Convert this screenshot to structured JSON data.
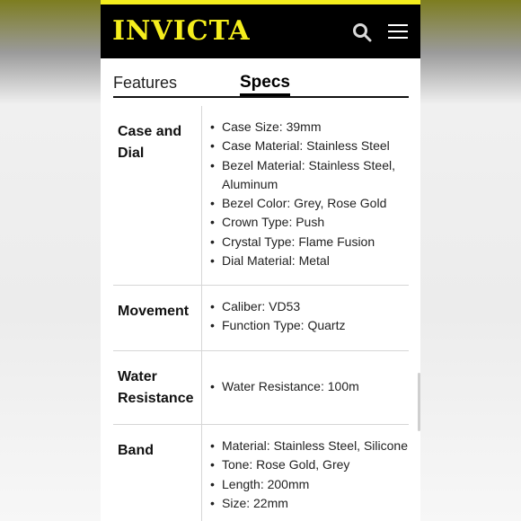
{
  "header": {
    "logo": "INVICTA",
    "search_icon": "search-icon",
    "menu_icon": "hamburger-menu-icon",
    "brand_color": "#f5ee1d"
  },
  "tabs": [
    {
      "label": "Features",
      "active": false
    },
    {
      "label": "Specs",
      "active": true
    }
  ],
  "specs": [
    {
      "label": "Case and Dial",
      "items": [
        "Case Size: 39mm",
        "Case Material: Stainless Steel",
        "Bezel Material: Stainless Steel, Aluminum",
        "Bezel Color: Grey, Rose Gold",
        "Crown Type: Push",
        "Crystal Type: Flame Fusion",
        "Dial Material: Metal"
      ]
    },
    {
      "label": "Movement",
      "items": [
        "Caliber: VD53",
        "Function Type: Quartz"
      ]
    },
    {
      "label": "Water Resistance",
      "items": [
        "Water Resistance: 100m"
      ]
    },
    {
      "label": "Band",
      "items": [
        "Material: Stainless Steel, Silicone",
        "Tone: Rose Gold, Grey",
        "Length: 200mm",
        "Size: 22mm"
      ]
    }
  ]
}
